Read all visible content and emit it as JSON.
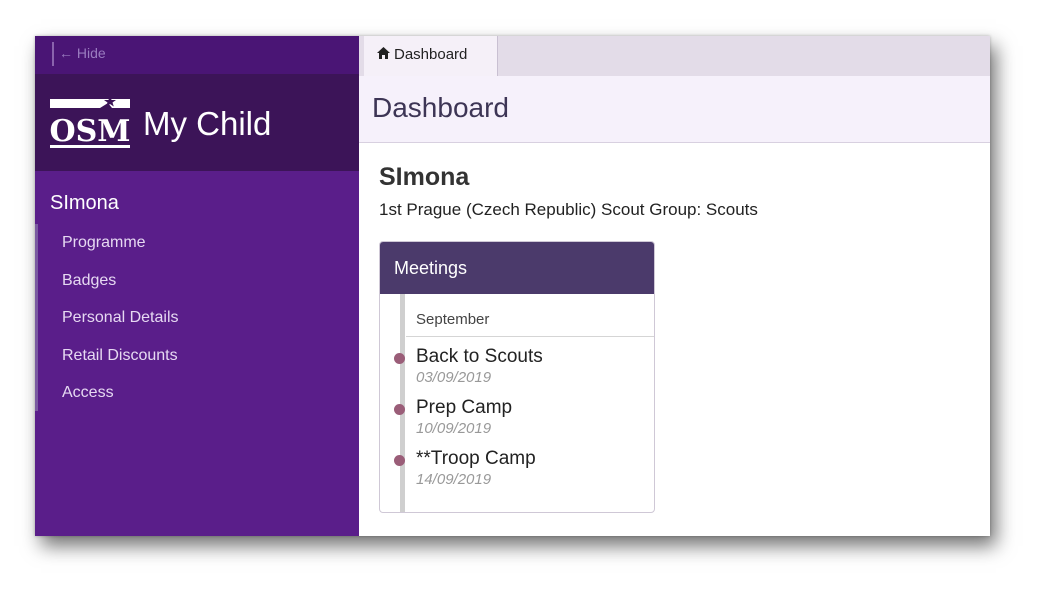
{
  "sidebar": {
    "hide_label": "← Hide",
    "brand": {
      "logo_text": "OSM",
      "title": "My Child"
    },
    "child_name": "SImona",
    "nav": [
      {
        "label": "Programme"
      },
      {
        "label": "Badges"
      },
      {
        "label": "Personal Details"
      },
      {
        "label": "Retail Discounts"
      },
      {
        "label": "Access"
      }
    ]
  },
  "tabs": [
    {
      "label": "Dashboard",
      "icon": "home-icon"
    }
  ],
  "page": {
    "title": "Dashboard"
  },
  "member": {
    "name": "SImona",
    "group": "1st Prague (Czech Republic) Scout Group: Scouts"
  },
  "meetings": {
    "title": "Meetings",
    "month": "September",
    "events": [
      {
        "title": "Back to Scouts",
        "date": "03/09/2019"
      },
      {
        "title": "Prep Camp",
        "date": "10/09/2019"
      },
      {
        "title": "**Troop Camp",
        "date": "14/09/2019"
      }
    ]
  },
  "colors": {
    "sidebar": "#5a1e8a",
    "brand_bar": "#3c1458",
    "card_header": "#4b3a6b",
    "timeline_dot": "#9a5d78"
  }
}
